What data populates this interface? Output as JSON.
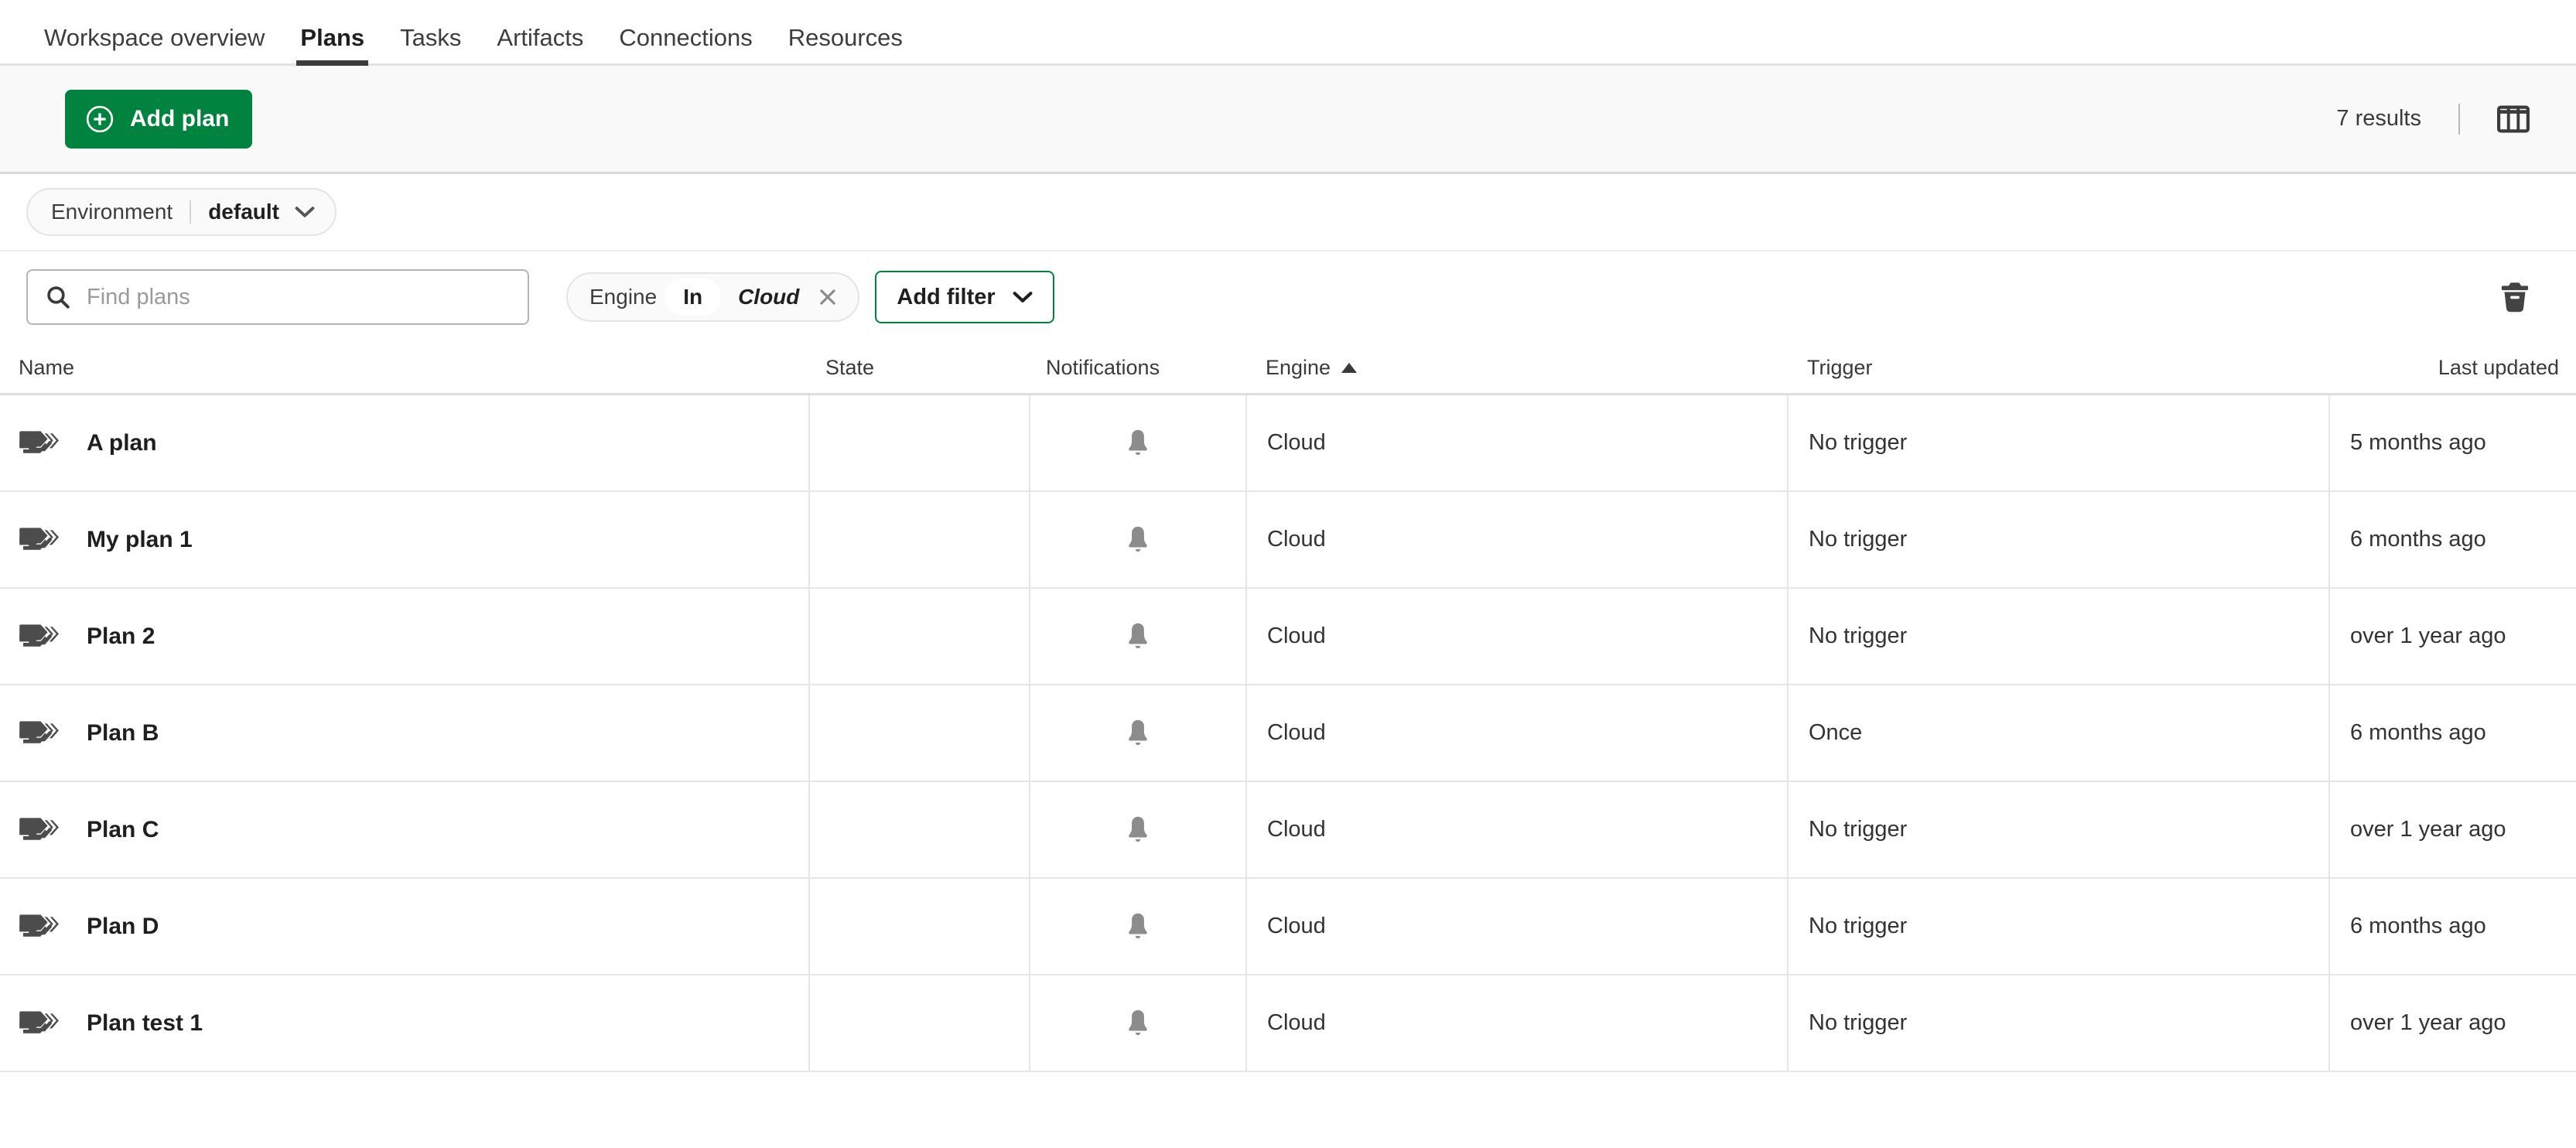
{
  "nav": {
    "tabs": [
      {
        "label": "Workspace overview",
        "active": false
      },
      {
        "label": "Plans",
        "active": true
      },
      {
        "label": "Tasks",
        "active": false
      },
      {
        "label": "Artifacts",
        "active": false
      },
      {
        "label": "Connections",
        "active": false
      },
      {
        "label": "Resources",
        "active": false
      }
    ]
  },
  "toolbar": {
    "add_plan_label": "Add plan",
    "add_plan_icon": "plus-circle-icon",
    "results_text": "7 results",
    "columns_icon": "columns-icon",
    "accent_color": "#00833e"
  },
  "environment": {
    "label": "Environment",
    "value": "default",
    "chevron_icon": "chevron-down-icon"
  },
  "search": {
    "placeholder": "Find plans",
    "value": "",
    "icon": "search-icon"
  },
  "filters": {
    "chip": {
      "key": "Engine",
      "operator": "In",
      "value": "Cloud",
      "remove_icon": "close-icon"
    },
    "add_filter_label": "Add filter",
    "add_filter_icon": "chevron-down-icon",
    "clear_icon": "trash-icon"
  },
  "table": {
    "columns": [
      {
        "key": "name",
        "label": "Name",
        "sorted": false
      },
      {
        "key": "state",
        "label": "State",
        "sorted": false
      },
      {
        "key": "notifications",
        "label": "Notifications",
        "sorted": false
      },
      {
        "key": "engine",
        "label": "Engine",
        "sorted": true,
        "sort_direction": "asc"
      },
      {
        "key": "trigger",
        "label": "Trigger",
        "sorted": false
      },
      {
        "key": "last_updated",
        "label": "Last updated",
        "sorted": false
      }
    ],
    "rows": [
      {
        "icon": "plan-stack-icon",
        "name": "A plan",
        "state": "",
        "notifications": "bell-icon",
        "engine": "Cloud",
        "trigger": "No trigger",
        "last_updated": "5 months ago"
      },
      {
        "icon": "plan-stack-icon",
        "name": "My plan 1",
        "state": "",
        "notifications": "bell-icon",
        "engine": "Cloud",
        "trigger": "No trigger",
        "last_updated": "6 months ago"
      },
      {
        "icon": "plan-stack-icon",
        "name": "Plan 2",
        "state": "",
        "notifications": "bell-icon",
        "engine": "Cloud",
        "trigger": "No trigger",
        "last_updated": "over 1 year ago"
      },
      {
        "icon": "plan-stack-icon",
        "name": "Plan B",
        "state": "",
        "notifications": "bell-icon",
        "engine": "Cloud",
        "trigger": "Once",
        "last_updated": "6 months ago"
      },
      {
        "icon": "plan-stack-icon",
        "name": "Plan C",
        "state": "",
        "notifications": "bell-icon",
        "engine": "Cloud",
        "trigger": "No trigger",
        "last_updated": "over 1 year ago"
      },
      {
        "icon": "plan-stack-icon",
        "name": "Plan D",
        "state": "",
        "notifications": "bell-icon",
        "engine": "Cloud",
        "trigger": "No trigger",
        "last_updated": "6 months ago"
      },
      {
        "icon": "plan-stack-icon",
        "name": "Plan test 1",
        "state": "",
        "notifications": "bell-icon",
        "engine": "Cloud",
        "trigger": "No trigger",
        "last_updated": "over 1 year ago"
      }
    ]
  }
}
